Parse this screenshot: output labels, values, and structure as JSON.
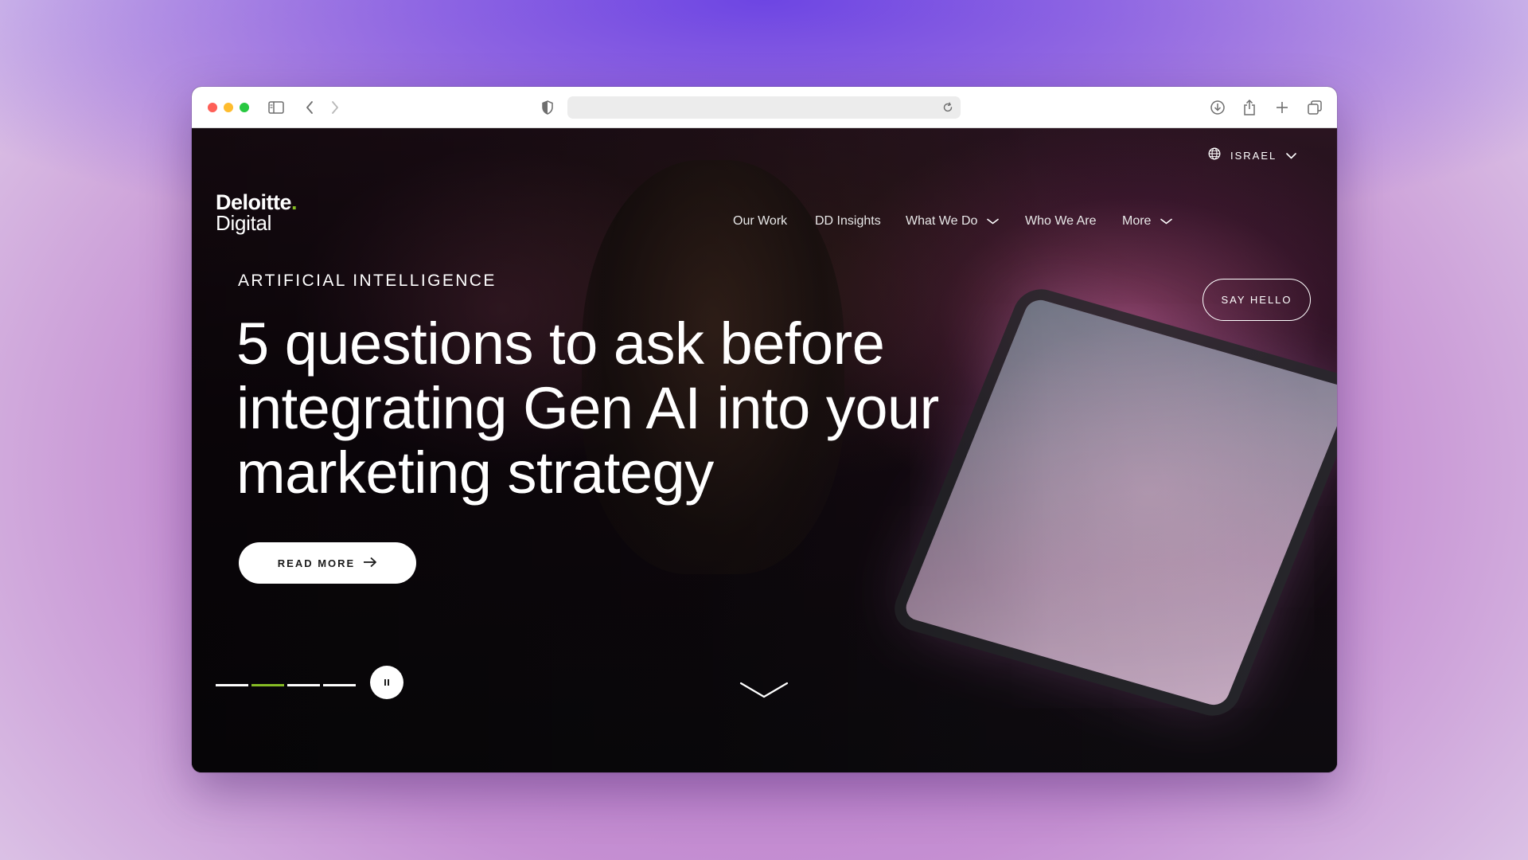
{
  "browser": {
    "icons": {
      "sidebar": "sidebar-icon",
      "back": "chevron-left-icon",
      "forward": "chevron-right-icon",
      "shield": "shield-icon",
      "reload": "reload-icon",
      "download": "download-icon",
      "share": "share-icon",
      "new_tab": "plus-icon",
      "tabs": "tabs-overview-icon"
    },
    "url": ""
  },
  "site": {
    "logo": {
      "line1": "Deloitte",
      "dot": ".",
      "line2": "Digital"
    },
    "region": {
      "label": "ISRAEL",
      "icon": "globe-icon"
    },
    "nav": [
      {
        "label": "Our Work"
      },
      {
        "label": "DD Insights"
      },
      {
        "label": "What We Do",
        "dropdown": true
      },
      {
        "label": "Who We Are"
      },
      {
        "label": "More",
        "dropdown": true
      }
    ],
    "cta": "SAY HELLO"
  },
  "hero": {
    "eyebrow": "ARTIFICIAL INTELLIGENCE",
    "headline_lines": [
      "5 questions to ask before",
      "integrating Gen AI into your",
      "marketing strategy"
    ],
    "button": "READ MORE",
    "carousel": {
      "slides": 4,
      "active_index": 1
    }
  },
  "colors": {
    "accent_green": "#86bc25",
    "toolbar_bg": "#ffffff",
    "text_on_dark": "#ffffff"
  }
}
